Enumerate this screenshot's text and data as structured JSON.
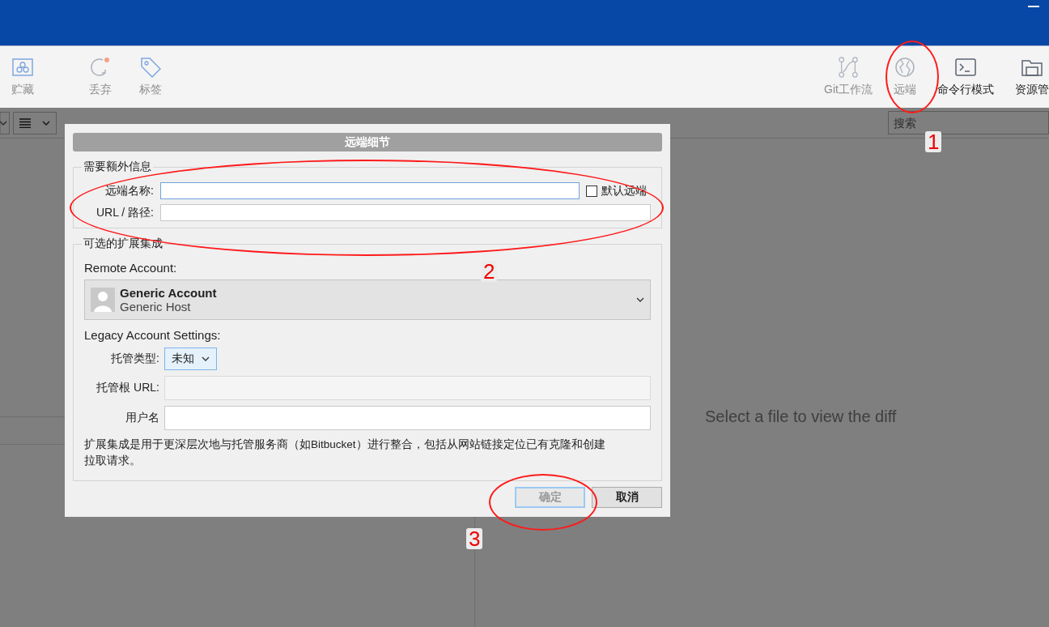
{
  "toolbar": {
    "left_items": [
      {
        "label": "贮藏",
        "disabled": true
      },
      {
        "label": "丢弃",
        "disabled": true
      },
      {
        "label": "标签",
        "disabled": true
      }
    ],
    "right_items": [
      {
        "label": "Git工作流",
        "disabled": true
      },
      {
        "label": "远端",
        "disabled": true
      },
      {
        "label": "命令行模式",
        "disabled": false
      },
      {
        "label": "资源管",
        "disabled": false
      }
    ]
  },
  "search": {
    "placeholder": "搜索"
  },
  "diff_panel": {
    "message": "Select a file to view the diff"
  },
  "dialog": {
    "title": "远端细节",
    "required_group": {
      "legend": "需要额外信息",
      "name_label": "远端名称:",
      "default_remote": {
        "label": "默认远端",
        "checked": false
      },
      "url_label": "URL / 路径:"
    },
    "optional_group": {
      "legend": "可选的扩展集成",
      "remote_account_label": "Remote Account:",
      "account": {
        "name": "Generic Account",
        "host": "Generic Host"
      },
      "legacy_label": "Legacy Account Settings:",
      "host_type_label": "托管类型:",
      "host_type_value": "未知",
      "host_root_label": "托管根 URL:",
      "username_label": "用户名",
      "note": "扩展集成是用于更深层次地与托管服务商（如Bitbucket）进行整合，包括从网站链接定位已有克隆和创建拉取请求。"
    },
    "buttons": [
      {
        "label": "确定",
        "disabled": true
      },
      {
        "label": "取消",
        "disabled": false
      }
    ]
  },
  "annotations": [
    {
      "number": "1"
    },
    {
      "number": "2"
    },
    {
      "number": "3"
    }
  ]
}
